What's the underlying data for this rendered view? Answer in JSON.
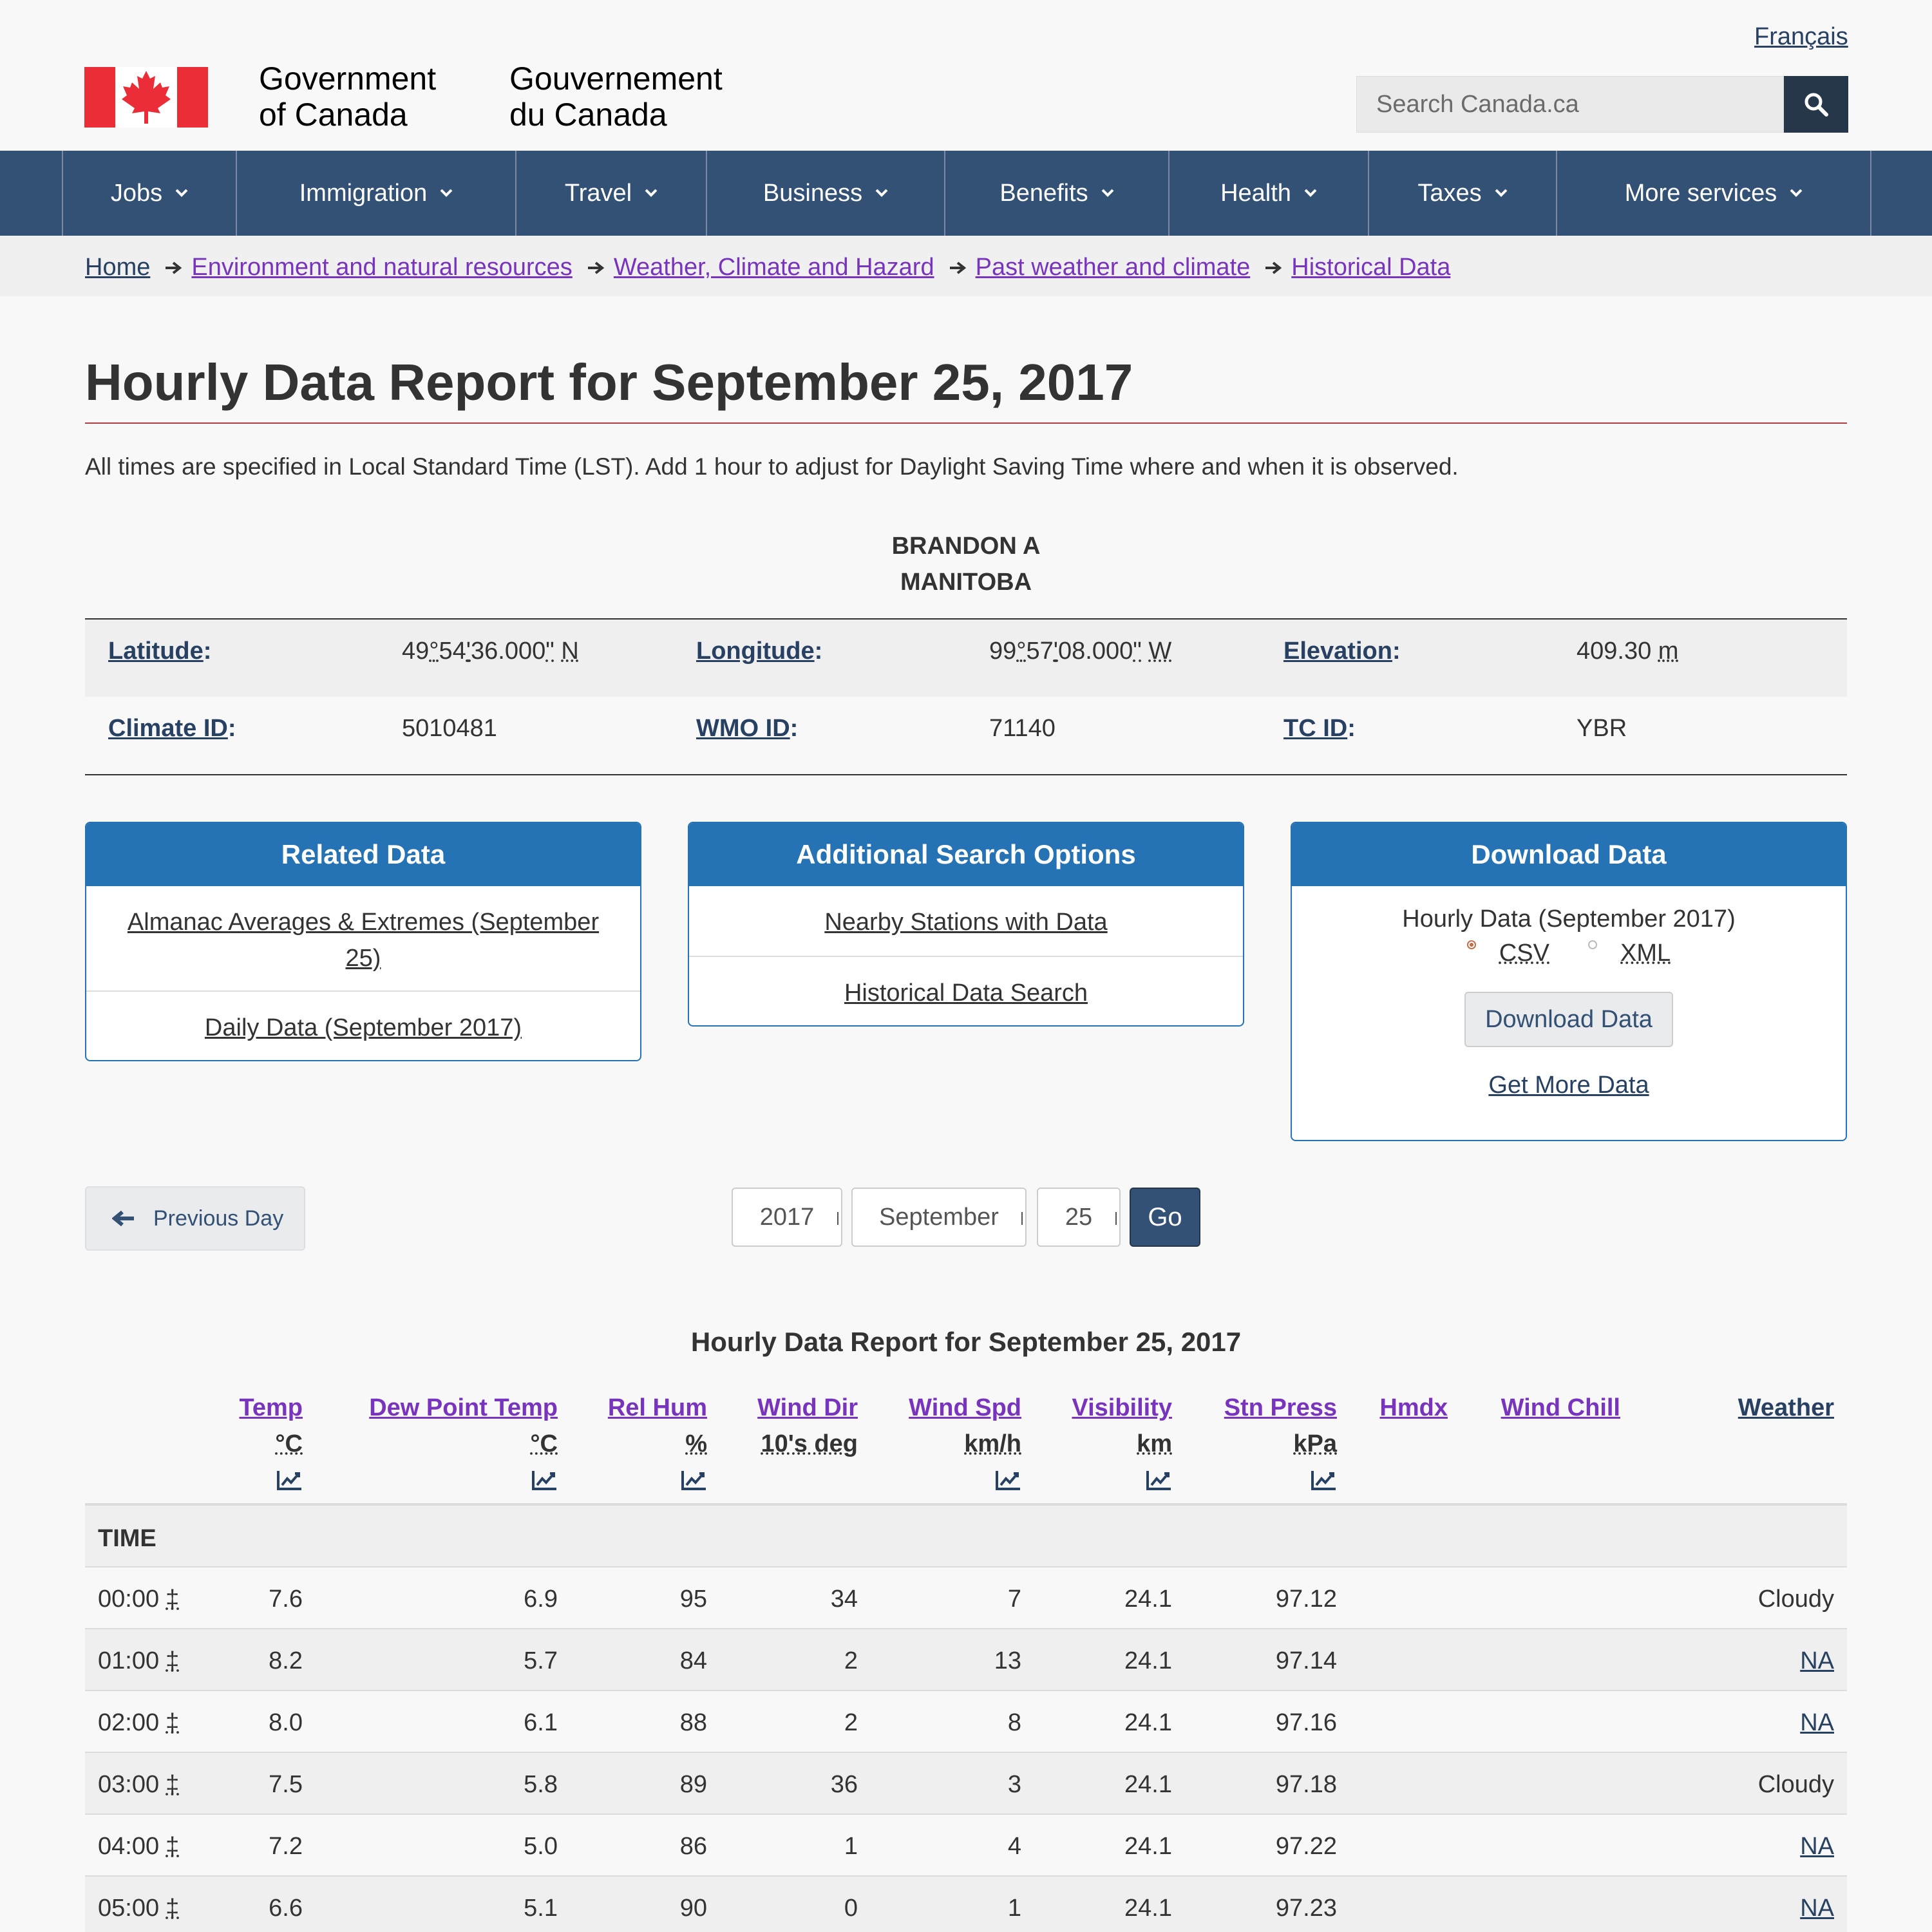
{
  "header": {
    "language_link": "Français",
    "signature_en": [
      "Government",
      "of Canada"
    ],
    "signature_fr": [
      "Gouvernement",
      "du Canada"
    ],
    "search_placeholder": "Search Canada.ca",
    "flag_colors": {
      "red": "#eb2d37",
      "white": "#ffffff"
    }
  },
  "menu": {
    "items": [
      "Jobs",
      "Immigration",
      "Travel",
      "Business",
      "Benefits",
      "Health",
      "Taxes",
      "More services"
    ],
    "background": "#335075"
  },
  "breadcrumb": [
    "Home",
    "Environment and natural resources",
    "Weather, Climate and Hazard",
    "Past weather and climate",
    "Historical Data"
  ],
  "page": {
    "title": "Hourly Data Report for September 25, 2017",
    "intro": "All times are specified in Local Standard Time (LST). Add 1 hour to adjust for Daylight Saving Time where and when it is observed."
  },
  "station": {
    "name": "BRANDON A",
    "province": "MANITOBA",
    "latitude_label": "Latitude",
    "latitude_deg": "49",
    "latitude_min": "54",
    "latitude_sec": "36.000",
    "latitude_dir": "N",
    "longitude_label": "Longitude",
    "longitude_deg": "99",
    "longitude_min": "57",
    "longitude_sec": "08.000",
    "longitude_dir": "W",
    "elevation_label": "Elevation",
    "elevation_value": "409.30",
    "elevation_unit": "m",
    "climate_id_label": "Climate ID",
    "climate_id": "5010481",
    "wmo_id_label": "WMO ID",
    "wmo_id": "71140",
    "tc_id_label": "TC ID",
    "tc_id": "YBR"
  },
  "panels": {
    "related": {
      "title": "Related Data",
      "links": [
        "Almanac Averages & Extremes (September 25)",
        "Daily Data (September 2017)"
      ]
    },
    "search": {
      "title": "Additional Search Options",
      "links": [
        "Nearby Stations with Data",
        "Historical Data Search"
      ]
    },
    "download": {
      "title": "Download Data",
      "description": "Hourly Data (September 2017)",
      "format_csv": "CSV",
      "format_xml": "XML",
      "selected_format": "CSV",
      "button": "Download Data",
      "more_link": "Get More Data"
    },
    "accent": "#2572b4"
  },
  "navigation": {
    "previous": "Previous Day",
    "year": "2017",
    "month": "September",
    "day": "25",
    "go": "Go"
  },
  "table": {
    "caption": "Hourly Data Report for September 25, 2017",
    "columns": [
      {
        "name": "Temp",
        "unit": "°C",
        "graph": true
      },
      {
        "name": "Dew Point Temp",
        "unit": "°C",
        "graph": true
      },
      {
        "name": "Rel Hum",
        "unit": "%",
        "graph": true
      },
      {
        "name": "Wind Dir",
        "unit": "10's deg",
        "graph": false
      },
      {
        "name": "Wind Spd",
        "unit": "km/h",
        "graph": true
      },
      {
        "name": "Visibility",
        "unit": "km",
        "graph": true
      },
      {
        "name": "Stn Press",
        "unit": "kPa",
        "graph": true
      },
      {
        "name": "Hmdx",
        "unit": "",
        "graph": false
      },
      {
        "name": "Wind Chill",
        "unit": "",
        "graph": false
      },
      {
        "name": "Weather",
        "unit": "",
        "graph": false
      }
    ],
    "time_label": "TIME",
    "time_flag": "‡",
    "rows": [
      {
        "time": "00:00",
        "temp": "7.6",
        "dew": "6.9",
        "hum": "95",
        "dir": "34",
        "spd": "7",
        "vis": "24.1",
        "press": "97.12",
        "hmdx": "",
        "chill": "",
        "weather": "Cloudy"
      },
      {
        "time": "01:00",
        "temp": "8.2",
        "dew": "5.7",
        "hum": "84",
        "dir": "2",
        "spd": "13",
        "vis": "24.1",
        "press": "97.14",
        "hmdx": "",
        "chill": "",
        "weather": "NA"
      },
      {
        "time": "02:00",
        "temp": "8.0",
        "dew": "6.1",
        "hum": "88",
        "dir": "2",
        "spd": "8",
        "vis": "24.1",
        "press": "97.16",
        "hmdx": "",
        "chill": "",
        "weather": "NA"
      },
      {
        "time": "03:00",
        "temp": "7.5",
        "dew": "5.8",
        "hum": "89",
        "dir": "36",
        "spd": "3",
        "vis": "24.1",
        "press": "97.18",
        "hmdx": "",
        "chill": "",
        "weather": "Cloudy"
      },
      {
        "time": "04:00",
        "temp": "7.2",
        "dew": "5.0",
        "hum": "86",
        "dir": "1",
        "spd": "4",
        "vis": "24.1",
        "press": "97.22",
        "hmdx": "",
        "chill": "",
        "weather": "NA"
      },
      {
        "time": "05:00",
        "temp": "6.6",
        "dew": "5.1",
        "hum": "90",
        "dir": "0",
        "spd": "1",
        "vis": "24.1",
        "press": "97.23",
        "hmdx": "",
        "chill": "",
        "weather": "NA"
      }
    ]
  }
}
